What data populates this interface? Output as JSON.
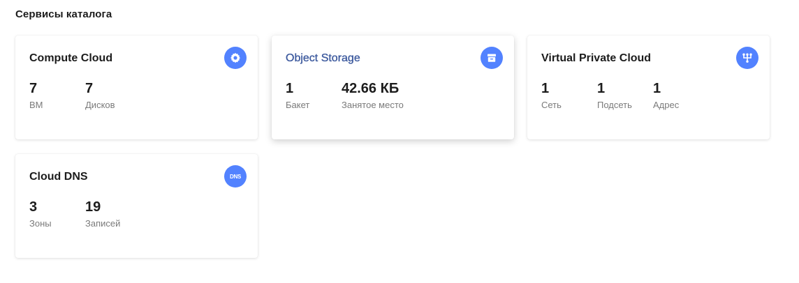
{
  "section_title": "Сервисы каталога",
  "accent_color": "#5282ff",
  "hover_title_color": "#3d5a9e",
  "cards": [
    {
      "title": "Compute Cloud",
      "icon": "gear-icon",
      "stats": [
        {
          "value": "7",
          "label": "ВМ"
        },
        {
          "value": "7",
          "label": "Дисков"
        }
      ]
    },
    {
      "title": "Object Storage",
      "icon": "storage-box-icon",
      "stats": [
        {
          "value": "1",
          "label": "Бакет"
        },
        {
          "value": "42.66 КБ",
          "label": "Занятое место"
        }
      ]
    },
    {
      "title": "Virtual Private Cloud",
      "icon": "network-icon",
      "stats": [
        {
          "value": "1",
          "label": "Сеть"
        },
        {
          "value": "1",
          "label": "Подсеть"
        },
        {
          "value": "1",
          "label": "Адрес"
        }
      ]
    },
    {
      "title": "Cloud DNS",
      "icon": "dns-icon",
      "icon_text": "DNS",
      "stats": [
        {
          "value": "3",
          "label": "Зоны"
        },
        {
          "value": "19",
          "label": "Записей"
        }
      ]
    }
  ]
}
